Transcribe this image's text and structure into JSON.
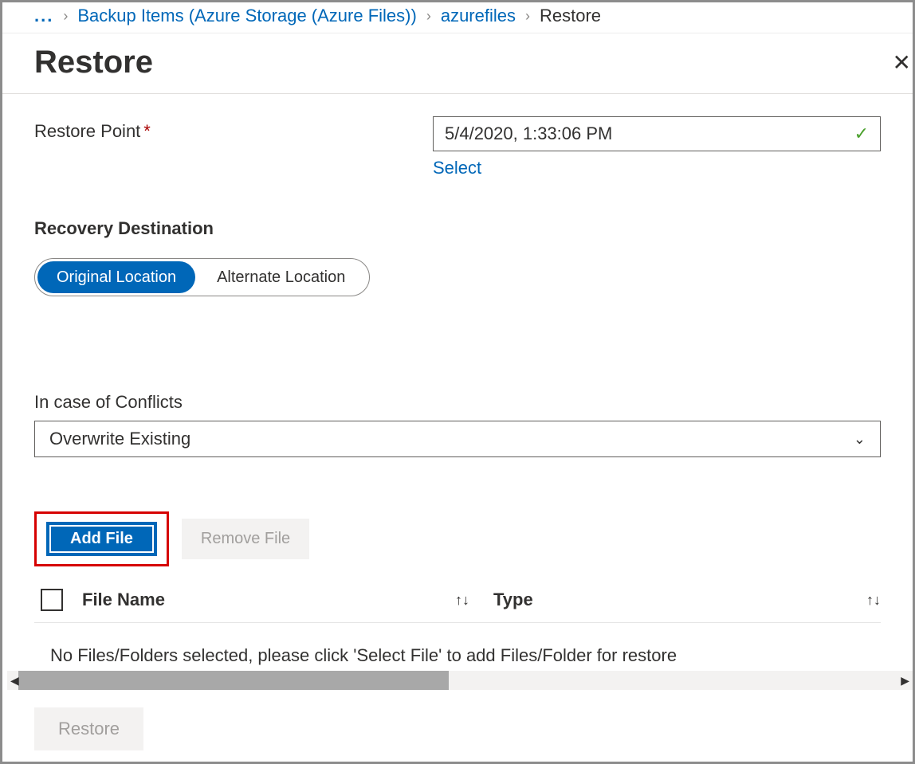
{
  "breadcrumb": {
    "ellipsis": "...",
    "items": [
      {
        "label": "Backup Items (Azure Storage (Azure Files))",
        "link": true
      },
      {
        "label": "azurefiles",
        "link": true
      },
      {
        "label": "Restore",
        "link": false
      }
    ]
  },
  "header": {
    "title": "Restore"
  },
  "restorePoint": {
    "label": "Restore Point",
    "value": "5/4/2020, 1:33:06 PM",
    "selectLabel": "Select"
  },
  "recoveryDestination": {
    "heading": "Recovery Destination",
    "options": {
      "original": "Original Location",
      "alternate": "Alternate Location"
    }
  },
  "conflicts": {
    "label": "In case of Conflicts",
    "value": "Overwrite Existing"
  },
  "fileButtons": {
    "add": "Add File",
    "remove": "Remove File"
  },
  "table": {
    "colFileName": "File Name",
    "colType": "Type",
    "emptyMessage": "No Files/Folders selected, please click 'Select File' to add Files/Folder for restore"
  },
  "footer": {
    "restore": "Restore"
  }
}
